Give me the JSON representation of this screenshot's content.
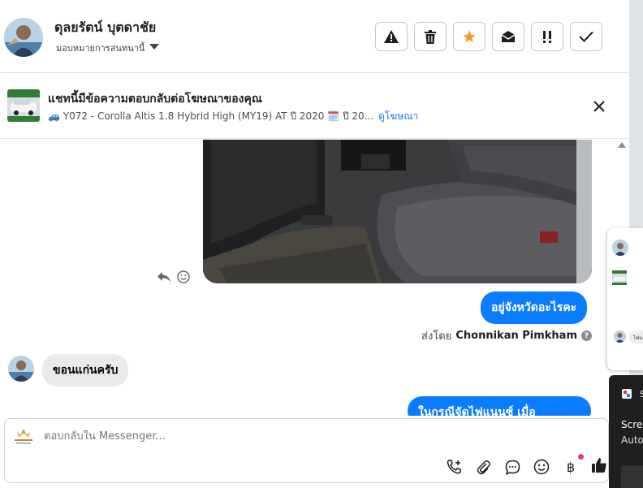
{
  "header": {
    "contact_name": "ดุลยรัตน์ บุตดาชัย",
    "assign_label": "มอบหมายการสนทนานี้",
    "actions": [
      {
        "icon": "warning-icon",
        "label": "spam"
      },
      {
        "icon": "trash-icon",
        "label": "delete"
      },
      {
        "icon": "star-icon",
        "label": "star"
      },
      {
        "icon": "envelope-open-icon",
        "label": "mark-unread"
      },
      {
        "icon": "priority-icon",
        "label": "follow-up"
      },
      {
        "icon": "check-icon",
        "label": "done"
      }
    ]
  },
  "ad_banner": {
    "title": "แชทนี้มีข้อความตอบกลับต่อโฆษณาของคุณ",
    "details": "🚙 Y072 - Corolla Altis 1.8 Hybrid High (MY19) AT ปี 2020 🗓️ ปี 20...",
    "link": "ดูโฆษณา"
  },
  "messages": {
    "outgoing_1": "อยู่จังหวัดอะไรคะ",
    "sent_by_prefix": "ส่งโดย",
    "sent_by_name": "Chonnikan Pimkham",
    "incoming_1": "ขอนแก่นครับ",
    "outgoing_2": "ในกรณีจัดไฟแนนซ์ เมื่อ"
  },
  "composer": {
    "placeholder": "ตอบกลับใน Messenger..."
  },
  "side": {
    "mini_bubble": "ไฟน",
    "dark_s": "S",
    "dark_line1": "Scre",
    "dark_line2": "Auto"
  },
  "colors": {
    "accent": "#0a7cff",
    "star": "#f79a1f",
    "notification": "#e4405f"
  }
}
